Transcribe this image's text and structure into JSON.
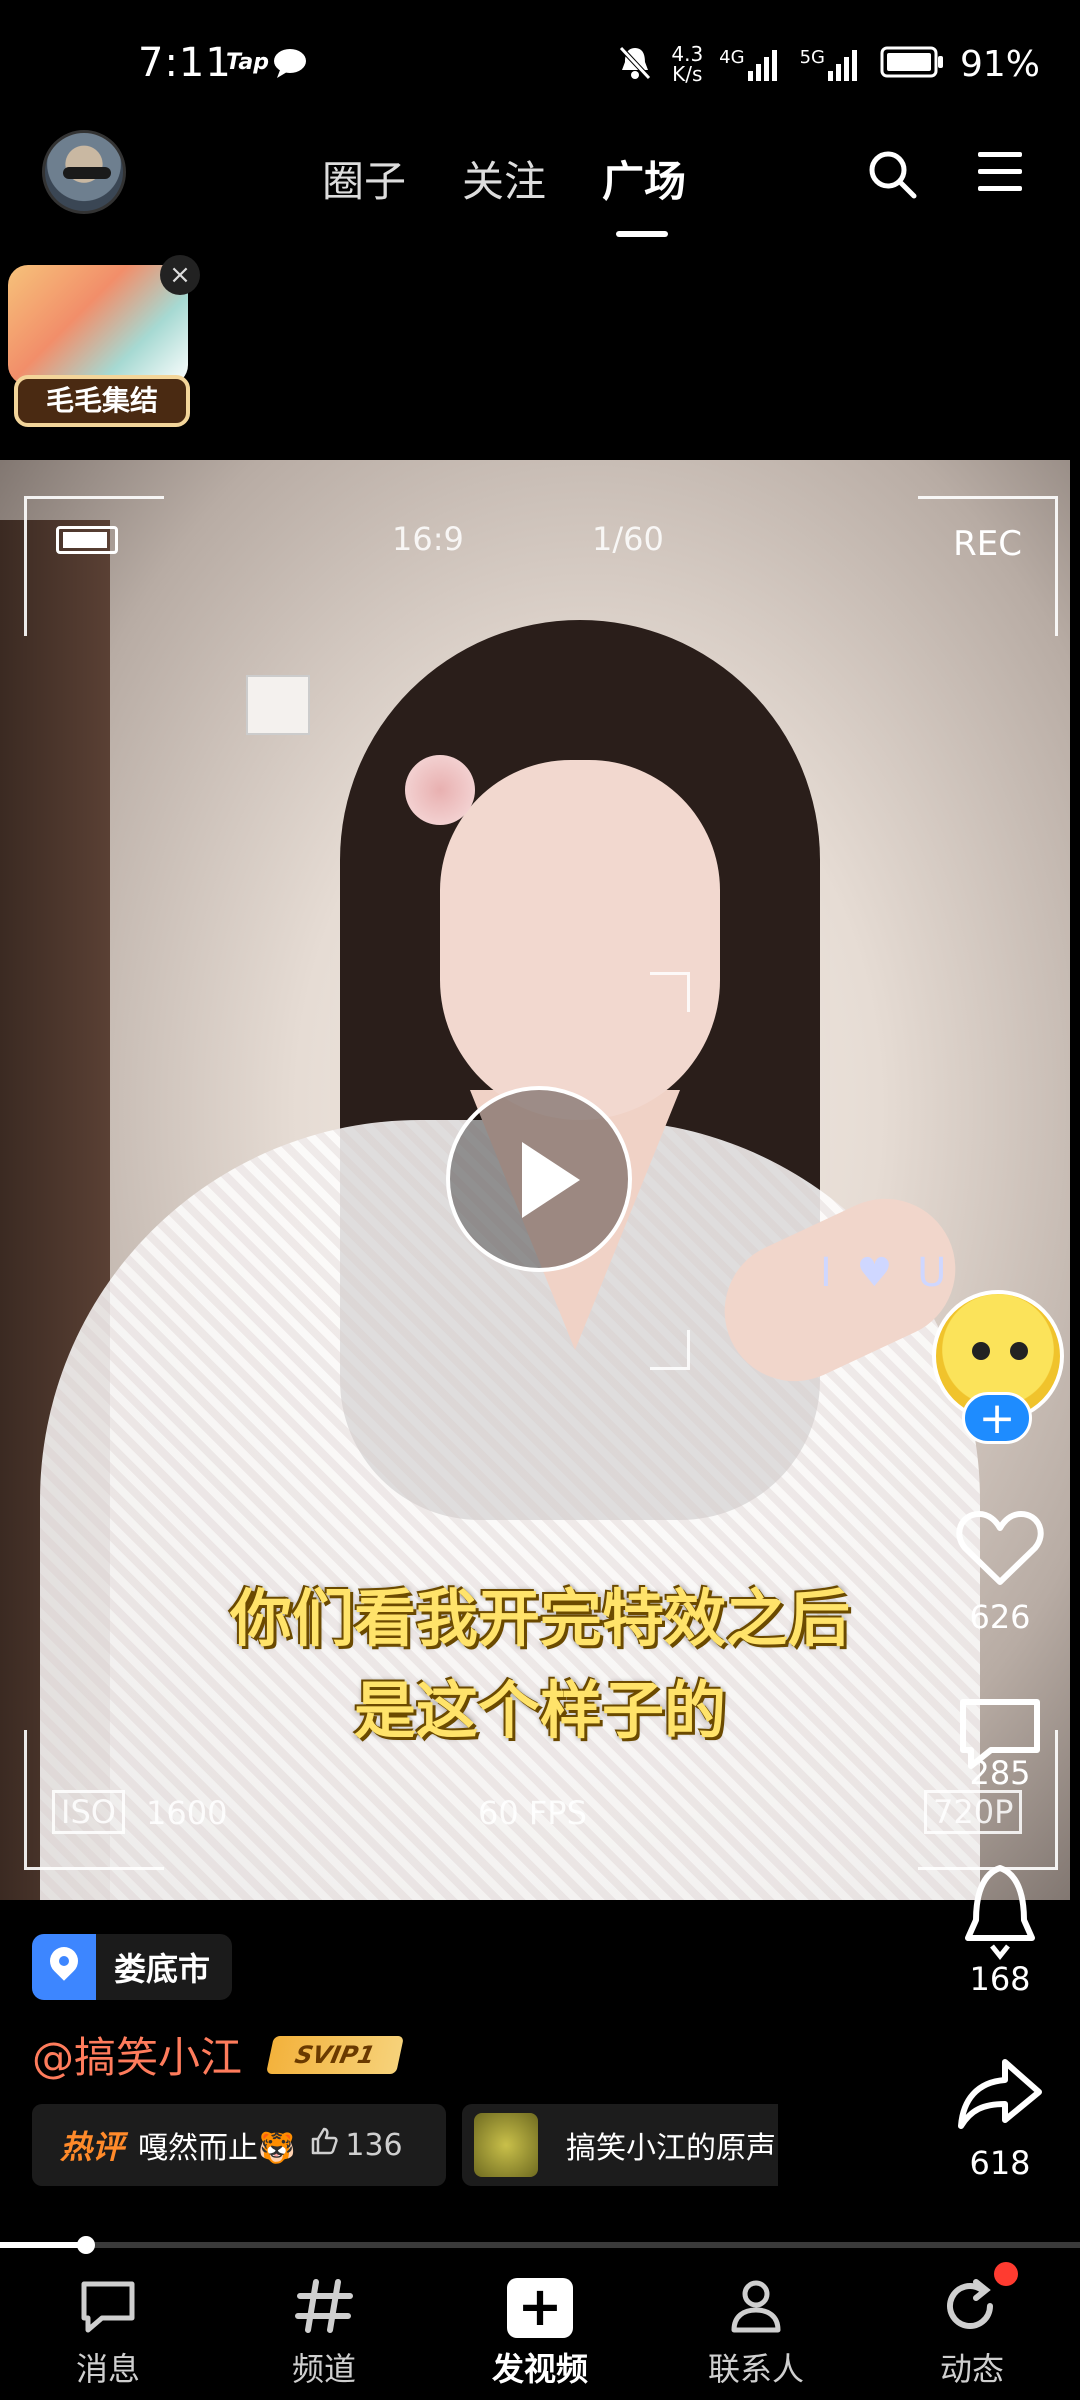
{
  "status_bar": {
    "time": "7:11",
    "tap_label": "Tap",
    "net_speed_value": "4.3",
    "net_speed_unit": "K/s",
    "network_1": "4G",
    "network_2": "5G",
    "battery_percent": "91%"
  },
  "top_nav": {
    "tabs": [
      "圈子",
      "关注",
      "广场"
    ],
    "active_tab": "广场"
  },
  "promo": {
    "label": "毛毛集结",
    "close": "×"
  },
  "video": {
    "aspect": "16:9",
    "shutter": "1/60",
    "rec": "REC",
    "iso_label": "ISO",
    "iso_value": "1600",
    "fps": "60  FPS",
    "resolution": "720P",
    "sticker": "I ♥ U",
    "caption_line1": "你们看我开完特效之后",
    "caption_line2": "是这个样子的"
  },
  "actions": {
    "likes": "626",
    "comments": "285",
    "boosts": "168",
    "shares": "618",
    "follow_plus": "+"
  },
  "info": {
    "location": "娄底市",
    "author": "@搞笑小江",
    "vip_badge": "SVIP1",
    "hot_tag": "热评",
    "hot_comment": "嘎然而止🐯",
    "hot_comment_likes": "136",
    "sound": "搞笑小江的原声"
  },
  "progress": {
    "fraction": 0.08
  },
  "bottom_nav": {
    "messages": "消息",
    "channels": "频道",
    "post_video": "发视频",
    "contacts": "联系人",
    "activity": "动态"
  },
  "colors": {
    "accent_blue": "#1e8cff",
    "author_color": "#ff7c5c",
    "caption_yellow": "#ffe36a",
    "notification_red": "#ff3b30"
  }
}
